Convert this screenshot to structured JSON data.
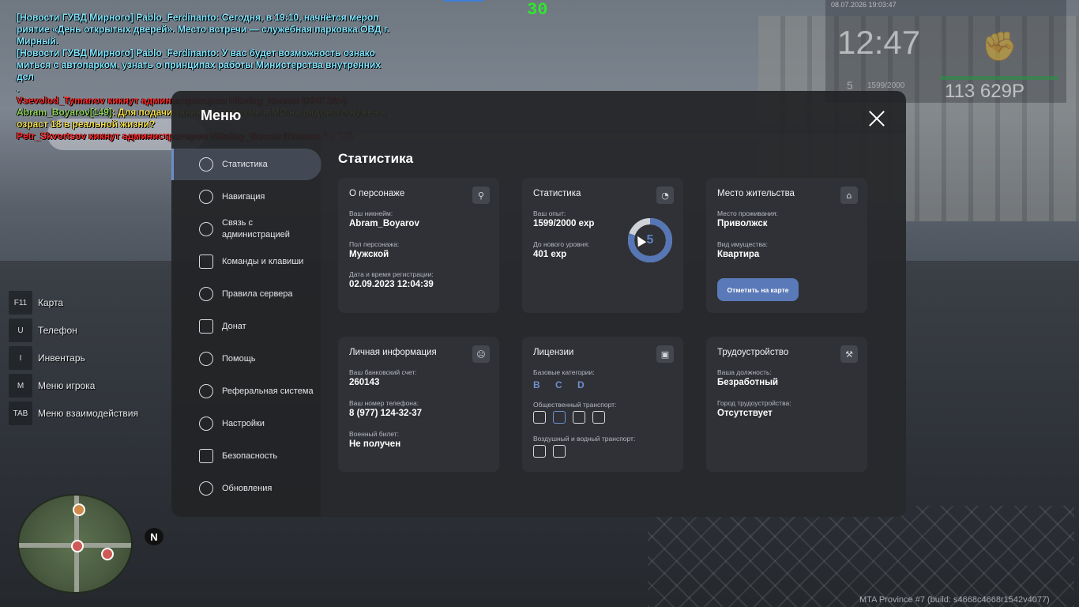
{
  "hud": {
    "fps": "30",
    "date": "08.07.2026 19:03:47",
    "time": "12:47",
    "money": "113 629Р",
    "level": "5",
    "exp": "1599/2000"
  },
  "chat": [
    {
      "cls": "cyan",
      "text": "[Новости ГУВД Мирного] Pablo_Ferdinanto: Сегодня, в 19:10, начнётся мероп"
    },
    {
      "cls": "cyan",
      "text": "риятие «День открытых дверей». Место встречи — служебная парковка ОВД г."
    },
    {
      "cls": "cyan",
      "text": " Мирный."
    },
    {
      "cls": "cyan",
      "text": "[Новости ГУВД Мирного] Pablo_Ferdinanto: У вас будет возможность ознако"
    },
    {
      "cls": "cyan",
      "text": "миться с автопарком, узнать о принципах работы Министерства внутренних дел"
    },
    {
      "cls": "cyan",
      "text": "."
    },
    {
      "cls": "kick",
      "text": "Vsevolod_Tymanov кикнут администратором Nikolay_Bosow (AFK 30+)"
    },
    {
      "cls": "yellow",
      "name": "Abram_Boyarov[149]",
      "text": ": Для подачи заявки на форуме в МО на рядового нужен в"
    },
    {
      "cls": "yellow",
      "text": "озраст 18 в реальной жизни?"
    },
    {
      "cls": "kick",
      "text": "Petr_Skvortsov кикнут администратором Nikolay_Bosow (Помеха by SZ)"
    }
  ],
  "hotkeys": [
    {
      "key": "F11",
      "label": "Карта"
    },
    {
      "key": "U",
      "label": "Телефон"
    },
    {
      "key": "I",
      "label": "Инвентарь"
    },
    {
      "key": "M",
      "label": "Меню игрока"
    },
    {
      "key": "TAB",
      "label": "Меню взаимодействия"
    }
  ],
  "minimap": {
    "north": "N"
  },
  "build": "MTA Province #7 (build: s4668c4668r1542v4077)",
  "menu": {
    "title": "Меню",
    "sidebar": [
      {
        "id": "stats",
        "label": "Статистика",
        "icon": "clock-chart-icon",
        "active": true
      },
      {
        "id": "nav",
        "label": "Навигация",
        "icon": "compass-icon"
      },
      {
        "id": "admin",
        "label": "Связь с администрацией",
        "icon": "headset-icon"
      },
      {
        "id": "commands",
        "label": "Команды и клавиши",
        "icon": "document-icon"
      },
      {
        "id": "rules",
        "label": "Правила сервера",
        "icon": "scales-icon"
      },
      {
        "id": "donate",
        "label": "Донат",
        "icon": "wallet-icon"
      },
      {
        "id": "help",
        "label": "Помощь",
        "icon": "heart-icon"
      },
      {
        "id": "referral",
        "label": "Реферальная система",
        "icon": "network-icon"
      },
      {
        "id": "settings",
        "label": "Настройки",
        "icon": "gear-icon"
      },
      {
        "id": "security",
        "label": "Безопасность",
        "icon": "shield-icon"
      },
      {
        "id": "updates",
        "label": "Обновления",
        "icon": "check-circle-icon"
      }
    ],
    "content_title": "Статистика",
    "cards": {
      "character": {
        "title": "О персонаже",
        "nick_label": "Ваш никнейм:",
        "nick": "Abram_Boyarov",
        "sex_label": "Пол персонажа:",
        "sex": "Мужской",
        "reg_label": "Дата и время регистрации:",
        "reg": "02.09.2023 12:04:39"
      },
      "stats": {
        "title": "Статистика",
        "exp_label": "Ваш опыт:",
        "exp": "1599/2000 exp",
        "next_label": "До нового уровня:",
        "next": "401 exp",
        "level": "5",
        "progress": 0.8
      },
      "residence": {
        "title": "Место жительства",
        "place_label": "Место проживания:",
        "place": "Приволжск",
        "type_label": "Вид имущества:",
        "type": "Квартира",
        "button": "Отметить на карте"
      },
      "personal": {
        "title": "Личная информация",
        "bank_label": "Ваш банковский счет:",
        "bank": "260143",
        "phone_label": "Ваш номер телефона:",
        "phone": "8 (977) 124-32-37",
        "military_label": "Военный билет:",
        "military": "Не получен"
      },
      "licenses": {
        "title": "Лицензии",
        "base_label": "Базовые категории:",
        "base": "B C D",
        "public_label": "Общественный транспорт:",
        "public_icons": [
          "bus-icon",
          "trolleybus-icon",
          "tram-icon",
          "train-icon"
        ],
        "air_label": "Воздушный и водный транспорт:",
        "air_icons": [
          "plane-icon",
          "helicopter-icon"
        ]
      },
      "job": {
        "title": "Трудоустройство",
        "pos_label": "Ваша должность:",
        "pos": "Безработный",
        "city_label": "Город трудоустройства:",
        "city": "Отсутствует"
      }
    }
  }
}
